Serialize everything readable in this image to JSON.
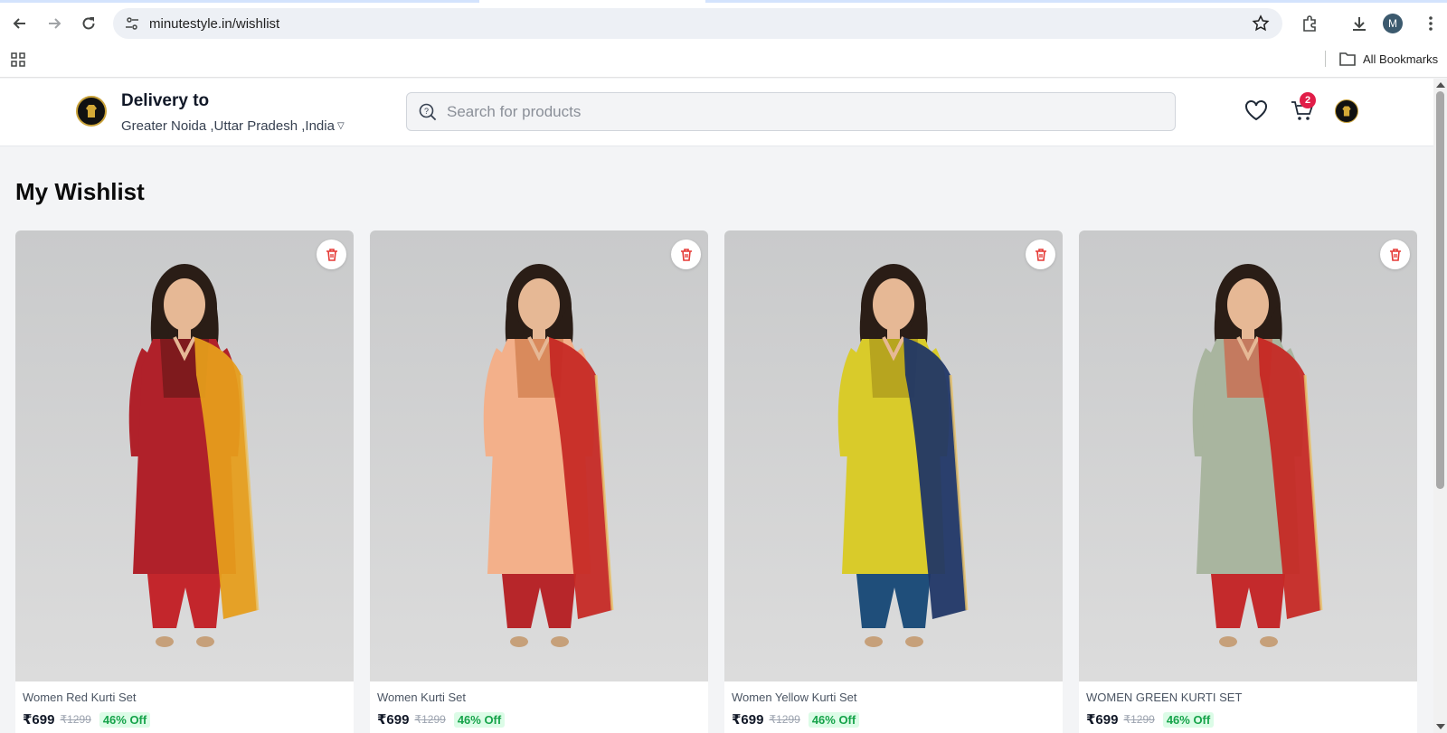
{
  "browser": {
    "url": "minutestyle.in/wishlist",
    "profile_initial": "M",
    "all_bookmarks_label": "All Bookmarks"
  },
  "header": {
    "delivery_title": "Delivery to",
    "delivery_location": "Greater Noida ,Uttar Pradesh ,India",
    "search_placeholder": "Search for products",
    "cart_count": "2"
  },
  "page": {
    "title": "My Wishlist"
  },
  "products": [
    {
      "name": "Women Red Kurti Set",
      "price": "₹699",
      "mrp": "₹1299",
      "discount": "46% Off",
      "top_color": "#b0212a",
      "yoke_color": "#7f1a1d",
      "dupatta_color": "#e59d1c",
      "bottom_color": "#c3262c"
    },
    {
      "name": "Women Kurti Set",
      "price": "₹699",
      "mrp": "₹1299",
      "discount": "46% Off",
      "top_color": "#f3b08a",
      "yoke_color": "#d98a5c",
      "dupatta_color": "#c62824",
      "bottom_color": "#b7262a"
    },
    {
      "name": "Women Yellow Kurti Set",
      "price": "₹699",
      "mrp": "₹1299",
      "discount": "46% Off",
      "top_color": "#d9cb2a",
      "yoke_color": "#b7a51f",
      "dupatta_color": "#1f3566",
      "bottom_color": "#1f4e7a"
    },
    {
      "name": "WOMEN GREEN KURTI SET",
      "price": "₹699",
      "mrp": "₹1299",
      "discount": "46% Off",
      "top_color": "#a9b59f",
      "yoke_color": "#c47a5f",
      "dupatta_color": "#c62824",
      "bottom_color": "#c42a2c"
    }
  ]
}
